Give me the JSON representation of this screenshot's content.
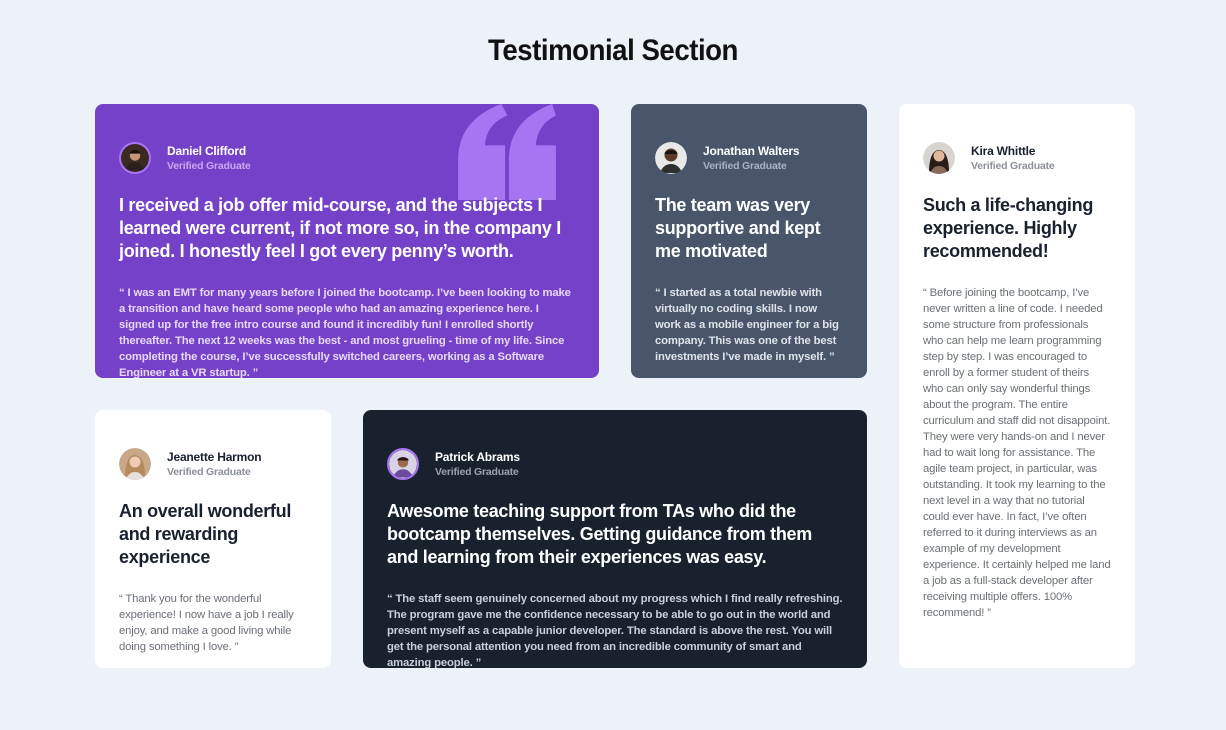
{
  "page": {
    "title": "Testimonial Section"
  },
  "testimonials": [
    {
      "name": "Daniel Clifford",
      "subtitle": "Verified Graduate",
      "headline": "I received a job offer mid-course, and the subjects I learned were current, if not more so, in the company I joined. I honestly feel I got every penny’s worth.",
      "quote": "“ I was an EMT for many years before I joined the bootcamp. I’ve been looking to make a transition and have heard some people who had an amazing experience here. I signed up for the free intro course and found it incredibly fun! I enrolled shortly thereafter. The next 12 weeks was the best - and most grueling - time of my life. Since completing the course, I’ve successfully switched careers, working as a Software Engineer at a VR startup. ”"
    },
    {
      "name": "Jonathan Walters",
      "subtitle": "Verified Graduate",
      "headline": "The team was very supportive and kept me motivated",
      "quote": "“ I started as a total newbie with virtually no coding skills. I now work as a mobile engineer for a big company. This was one of the best investments I’ve made in myself. ”"
    },
    {
      "name": "Kira Whittle",
      "subtitle": "Verified Graduate",
      "headline": "Such a life-changing experience. Highly recommended!",
      "quote": "“ Before joining the bootcamp, I’ve never written a line of code. I needed some structure from professionals who can help me learn programming step by step. I was encouraged to enroll by a former student of theirs who can only say wonderful things about the program. The entire curriculum and staff did not disappoint. They were very hands-on and I never had to wait long for assistance. The agile team project, in particular, was outstanding. It took my learning to the next level in a way that no tutorial could ever have. In fact, I’ve often referred to it during interviews as an example of my development experience. It certainly helped me land a job as a full-stack developer after receiving multiple offers. 100% recommend! ”"
    },
    {
      "name": "Jeanette Harmon",
      "subtitle": "Verified Graduate",
      "headline": "An overall wonderful and rewarding experience",
      "quote": "“ Thank you for the wonderful experience! I now have a job I really enjoy, and make a good living while doing something I love. ”"
    },
    {
      "name": "Patrick Abrams",
      "subtitle": "Verified Graduate",
      "headline": "Awesome teaching support from TAs who did the bootcamp themselves. Getting guidance from them and learning from their experiences was easy.",
      "quote": "“ The staff seem genuinely concerned about my progress which I find really refreshing. The program gave me the confidence necessary to be able to go out in the world and present myself as a capable junior developer. The standard is above the rest. You will get the personal attention you need from an incredible community of smart and amazing people. ”"
    }
  ],
  "colors": {
    "background": "#ecf2f8",
    "purple": "#7541c8",
    "grayish_blue": "#48556a",
    "dark_blue": "#19212e",
    "white": "#ffffff",
    "quote_mark": "#a775f1"
  },
  "icons": {
    "quote_mark": "quotation-mark-icon",
    "avatar": "user-avatar-photo"
  }
}
